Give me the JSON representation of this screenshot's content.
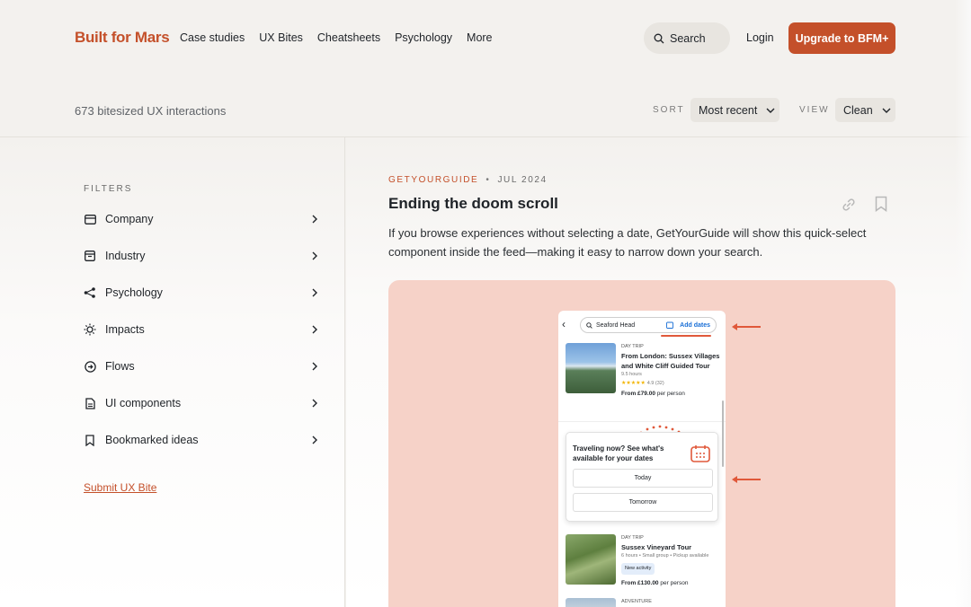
{
  "header": {
    "logo": "Built for Mars",
    "nav": [
      "Case studies",
      "UX Bites",
      "Cheatsheets",
      "Psychology",
      "More"
    ],
    "search_label": "Search",
    "login_label": "Login",
    "upgrade_label": "Upgrade to BFM+"
  },
  "subbar": {
    "count_text": "673 bitesized UX interactions",
    "sort_label": "SORT",
    "sort_value": "Most recent",
    "view_label": "VIEW",
    "view_value": "Clean"
  },
  "sidebar": {
    "title": "FILTERS",
    "items": [
      {
        "label": "Company",
        "icon": "card-icon"
      },
      {
        "label": "Industry",
        "icon": "box-icon"
      },
      {
        "label": "Psychology",
        "icon": "share-nodes-icon"
      },
      {
        "label": "Impacts",
        "icon": "sun-icon"
      },
      {
        "label": "Flows",
        "icon": "flow-circle-icon"
      },
      {
        "label": "UI components",
        "icon": "document-icon"
      },
      {
        "label": "Bookmarked ideas",
        "icon": "bookmark-icon"
      }
    ],
    "submit_label": "Submit UX Bite"
  },
  "post": {
    "company": "GETYOURGUIDE",
    "separator": "•",
    "date": "JUL 2024",
    "title": "Ending the doom scroll",
    "description": "If you browse experiences without selecting a date, GetYourGuide will show this quick-select component inside the feed—making it easy to narrow down your search."
  },
  "preview": {
    "search_text": "Seaford Head",
    "add_dates": "Add dates",
    "card1": {
      "tag": "DAY TRIP",
      "title": "From London: Sussex Villages and White Cliff Guided Tour",
      "duration": "9.5 hours",
      "stars": "★★★★★",
      "rating": "4.9 (32)",
      "price": "From £79.00",
      "price_suffix": "per person"
    },
    "quick_select": {
      "title": "Traveling now? See what's available for your dates",
      "today": "Today",
      "tomorrow": "Tomorrow"
    },
    "card2": {
      "tag": "DAY TRIP",
      "title": "Sussex Vineyard Tour",
      "details": "6 hours • Small group • Pickup available",
      "badge": "New activity",
      "price": "From £130.00",
      "price_suffix": "per person"
    },
    "card3_tag": "ADVENTURE"
  },
  "colors": {
    "brand": "#c4502a",
    "preview_bg": "#f6d2c8",
    "annotation": "#e0583a",
    "link_blue": "#1a6fd6"
  }
}
